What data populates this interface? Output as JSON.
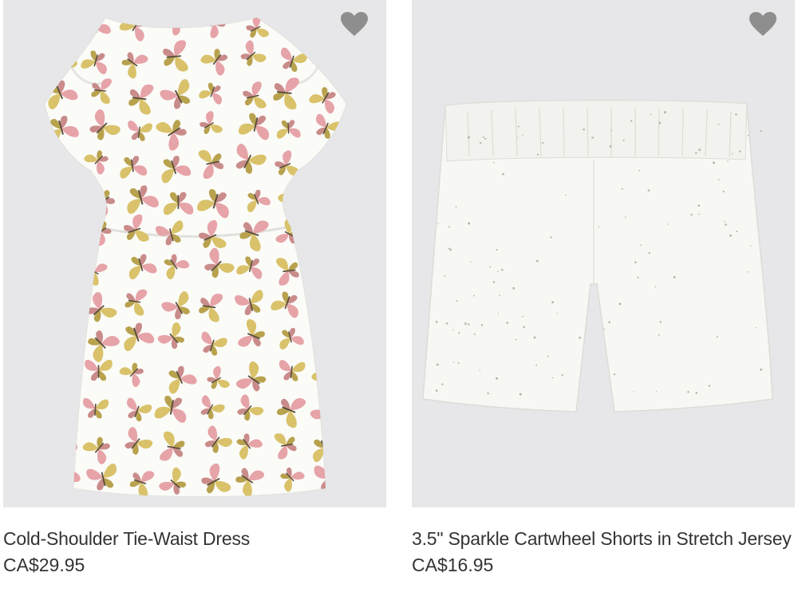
{
  "products": [
    {
      "name": "Cold-Shoulder Tie-Waist Dress",
      "price": "CA$29.95",
      "favorite_icon": "heart-icon"
    },
    {
      "name": "3.5\" Sparkle Cartwheel Shorts in Stretch Jersey",
      "price": "CA$16.95",
      "favorite_icon": "heart-icon"
    }
  ],
  "colors": {
    "image_background": "#e7e7e9",
    "heart": "#8e8e8e",
    "text": "#333333"
  }
}
